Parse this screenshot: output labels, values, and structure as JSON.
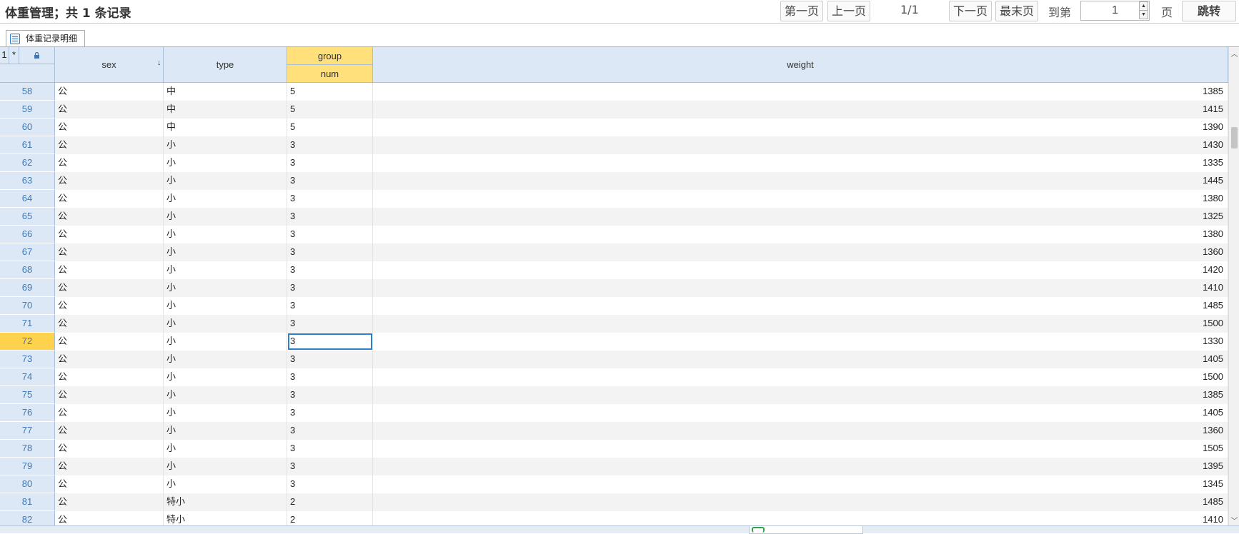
{
  "header": {
    "title": "体重管理；共 1 条记录",
    "first_page": "第一页",
    "prev_page": "上一页",
    "page_info": "1/1",
    "next_page": "下一页",
    "last_page": "最末页",
    "goto_label": "到第",
    "goto_value": "1",
    "page_unit": "页",
    "jump_button": "跳转"
  },
  "tab": {
    "label": "体重记录明细",
    "icon": "list-icon"
  },
  "grid": {
    "corner": {
      "level": "1",
      "star": "*",
      "lock_icon": "lock-icon"
    },
    "columns": {
      "sex": "sex",
      "type": "type",
      "group": "group",
      "num": "num",
      "weight": "weight"
    },
    "sort_icon": "sort-down-icon",
    "current_row": "72",
    "highlight_color": "#ffd24d",
    "rows": [
      {
        "n": "58",
        "sex": "公",
        "type": "中",
        "num": "5",
        "weight": "1385"
      },
      {
        "n": "59",
        "sex": "公",
        "type": "中",
        "num": "5",
        "weight": "1415"
      },
      {
        "n": "60",
        "sex": "公",
        "type": "中",
        "num": "5",
        "weight": "1390"
      },
      {
        "n": "61",
        "sex": "公",
        "type": "小",
        "num": "3",
        "weight": "1430"
      },
      {
        "n": "62",
        "sex": "公",
        "type": "小",
        "num": "3",
        "weight": "1335"
      },
      {
        "n": "63",
        "sex": "公",
        "type": "小",
        "num": "3",
        "weight": "1445"
      },
      {
        "n": "64",
        "sex": "公",
        "type": "小",
        "num": "3",
        "weight": "1380"
      },
      {
        "n": "65",
        "sex": "公",
        "type": "小",
        "num": "3",
        "weight": "1325"
      },
      {
        "n": "66",
        "sex": "公",
        "type": "小",
        "num": "3",
        "weight": "1380"
      },
      {
        "n": "67",
        "sex": "公",
        "type": "小",
        "num": "3",
        "weight": "1360"
      },
      {
        "n": "68",
        "sex": "公",
        "type": "小",
        "num": "3",
        "weight": "1420"
      },
      {
        "n": "69",
        "sex": "公",
        "type": "小",
        "num": "3",
        "weight": "1410"
      },
      {
        "n": "70",
        "sex": "公",
        "type": "小",
        "num": "3",
        "weight": "1485"
      },
      {
        "n": "71",
        "sex": "公",
        "type": "小",
        "num": "3",
        "weight": "1500"
      },
      {
        "n": "72",
        "sex": "公",
        "type": "小",
        "num": "3",
        "weight": "1330"
      },
      {
        "n": "73",
        "sex": "公",
        "type": "小",
        "num": "3",
        "weight": "1405"
      },
      {
        "n": "74",
        "sex": "公",
        "type": "小",
        "num": "3",
        "weight": "1500"
      },
      {
        "n": "75",
        "sex": "公",
        "type": "小",
        "num": "3",
        "weight": "1385"
      },
      {
        "n": "76",
        "sex": "公",
        "type": "小",
        "num": "3",
        "weight": "1405"
      },
      {
        "n": "77",
        "sex": "公",
        "type": "小",
        "num": "3",
        "weight": "1360"
      },
      {
        "n": "78",
        "sex": "公",
        "type": "小",
        "num": "3",
        "weight": "1505"
      },
      {
        "n": "79",
        "sex": "公",
        "type": "小",
        "num": "3",
        "weight": "1395"
      },
      {
        "n": "80",
        "sex": "公",
        "type": "小",
        "num": "3",
        "weight": "1345"
      },
      {
        "n": "81",
        "sex": "公",
        "type": "特小",
        "num": "2",
        "weight": "1485"
      },
      {
        "n": "82",
        "sex": "公",
        "type": "特小",
        "num": "2",
        "weight": "1410"
      }
    ]
  }
}
